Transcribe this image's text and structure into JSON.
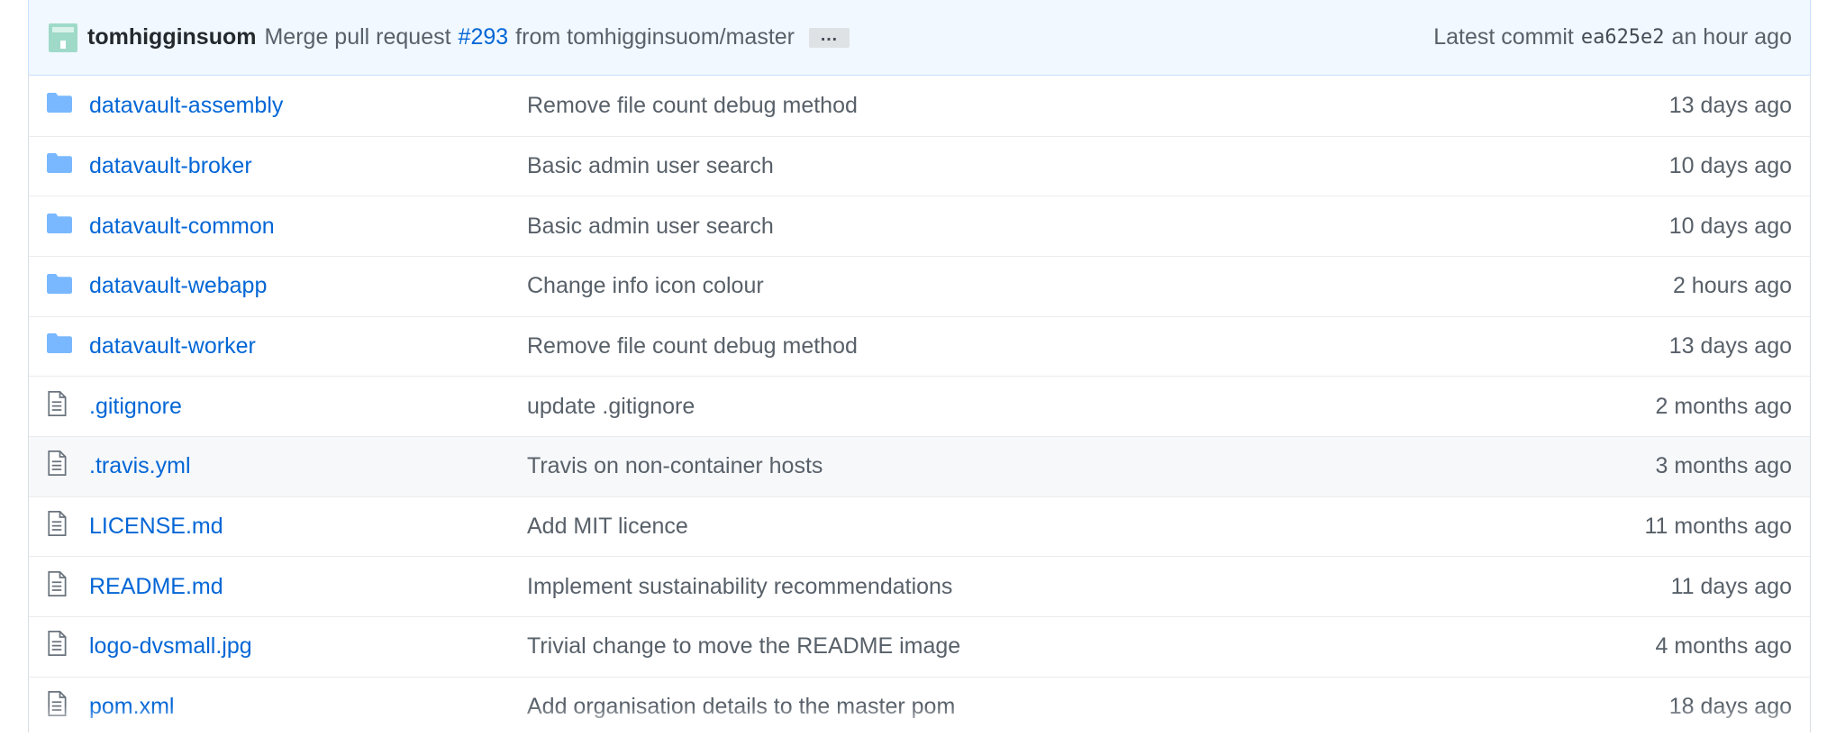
{
  "commit": {
    "author": "tomhigginsuom",
    "message_prefix": "Merge pull request",
    "pr_number": "#293",
    "message_suffix": "from tomhigginsuom/master",
    "ellipsis": "…",
    "latest_label": "Latest commit",
    "sha": "ea625e2",
    "age": "an hour ago"
  },
  "files": [
    {
      "type": "directory",
      "icon": "folder-icon",
      "name": "datavault-assembly",
      "message": "Remove file count debug method",
      "age": "13 days ago"
    },
    {
      "type": "directory",
      "icon": "folder-icon",
      "name": "datavault-broker",
      "message": "Basic admin user search",
      "age": "10 days ago"
    },
    {
      "type": "directory",
      "icon": "folder-icon",
      "name": "datavault-common",
      "message": "Basic admin user search",
      "age": "10 days ago"
    },
    {
      "type": "directory",
      "icon": "folder-icon",
      "name": "datavault-webapp",
      "message": "Change info icon colour",
      "age": "2 hours ago"
    },
    {
      "type": "directory",
      "icon": "folder-icon",
      "name": "datavault-worker",
      "message": "Remove file count debug method",
      "age": "13 days ago"
    },
    {
      "type": "file",
      "icon": "file-icon",
      "name": ".gitignore",
      "message": "update .gitignore",
      "age": "2 months ago"
    },
    {
      "type": "file",
      "icon": "file-icon",
      "name": ".travis.yml",
      "message": "Travis on non-container hosts",
      "age": "3 months ago",
      "highlighted": true
    },
    {
      "type": "file",
      "icon": "file-icon",
      "name": "LICENSE.md",
      "message": "Add MIT licence",
      "age": "11 months ago"
    },
    {
      "type": "file",
      "icon": "file-icon",
      "name": "README.md",
      "message": "Implement sustainability recommendations",
      "age": "11 days ago"
    },
    {
      "type": "file",
      "icon": "file-icon",
      "name": "logo-dvsmall.jpg",
      "message": "Trivial change to move the README image",
      "age": "4 months ago"
    },
    {
      "type": "file",
      "icon": "file-icon",
      "name": "pom.xml",
      "message": "Add organisation details to the master pom",
      "age": "18 days ago"
    }
  ],
  "colors": {
    "link": "#0366d6",
    "muted_text": "#586069",
    "folder": "#79b8ff",
    "commit_bar_bg": "#f1f8ff",
    "row_highlight": "#f6f8fa"
  }
}
